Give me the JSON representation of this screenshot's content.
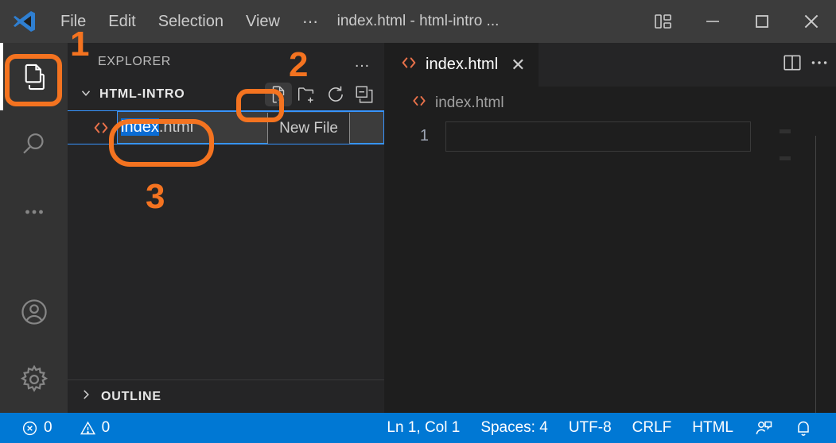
{
  "window": {
    "title": "index.html - html-intro ...",
    "logo": "vscode-logo"
  },
  "menubar": {
    "items": [
      {
        "label": "File"
      },
      {
        "label": "Edit"
      },
      {
        "label": "Selection"
      },
      {
        "label": "View"
      }
    ],
    "overflow_label": "…"
  },
  "window_controls": {
    "layout_label": "layout-icon",
    "minimize_label": "minimize-icon",
    "maximize_label": "maximize-icon",
    "close_label": "close-icon"
  },
  "activitybar": {
    "items": [
      {
        "name": "explorer",
        "icon": "files-icon",
        "active": true
      },
      {
        "name": "search",
        "icon": "search-icon",
        "active": false
      },
      {
        "name": "more",
        "icon": "ellipsis-icon",
        "active": false
      },
      {
        "name": "account",
        "icon": "account-icon",
        "active": false
      },
      {
        "name": "settings",
        "icon": "gear-icon",
        "active": false
      }
    ]
  },
  "sidebar": {
    "title": "EXPLORER",
    "more_actions": "…",
    "folder": {
      "name": "HTML-INTRO",
      "expanded": true,
      "chevron": "chevron-down-icon"
    },
    "toolbar": [
      {
        "name": "new-file",
        "icon": "new-file-icon",
        "highlighted": true
      },
      {
        "name": "new-folder",
        "icon": "new-folder-icon",
        "highlighted": false
      },
      {
        "name": "refresh",
        "icon": "refresh-icon",
        "highlighted": false
      },
      {
        "name": "collapse-all",
        "icon": "collapse-all-icon",
        "highlighted": false
      }
    ],
    "rename_row": {
      "file_icon": "html-file-icon",
      "selected_text": "index",
      "rest_text": ".html",
      "full_value": "index.html",
      "badge_label": "New File"
    },
    "outline": {
      "label": "OUTLINE",
      "expanded": false,
      "chevron": "chevron-right-icon"
    }
  },
  "editor": {
    "tab": {
      "icon": "html-file-icon",
      "label": "index.html",
      "close": "✕"
    },
    "actions": [
      {
        "name": "split-editor",
        "icon": "split-editor-icon"
      },
      {
        "name": "more-actions",
        "icon": "ellipsis-icon"
      }
    ],
    "breadcrumb": {
      "icon": "html-file-icon",
      "label": "index.html"
    },
    "lines": [
      {
        "number": "1",
        "text": ""
      }
    ]
  },
  "statusbar": {
    "left": [
      {
        "name": "errors",
        "icon": "error-icon",
        "value": "0"
      },
      {
        "name": "warnings",
        "icon": "warning-icon",
        "value": "0"
      }
    ],
    "right": [
      {
        "name": "cursor-position",
        "label": "Ln 1, Col 1"
      },
      {
        "name": "indentation",
        "label": "Spaces: 4"
      },
      {
        "name": "encoding",
        "label": "UTF-8"
      },
      {
        "name": "eol",
        "label": "CRLF"
      },
      {
        "name": "language-mode",
        "label": "HTML"
      },
      {
        "name": "feedback",
        "label": "feedback-icon"
      },
      {
        "name": "notifications",
        "label": "bell-icon"
      }
    ]
  },
  "annotations": [
    {
      "number": "1",
      "target": "explorer-activity-icon"
    },
    {
      "number": "2",
      "target": "new-file-button"
    },
    {
      "number": "3",
      "target": "rename-input"
    }
  ],
  "colors": {
    "accent_annotation": "#f47320",
    "statusbar": "#0078d4",
    "titlebar": "#3c3c3c",
    "sidebar": "#252526",
    "editor": "#1e1e1e",
    "activitybar": "#333333",
    "selection_blue": "#0a6cd4",
    "focus_border": "#3794ff"
  }
}
